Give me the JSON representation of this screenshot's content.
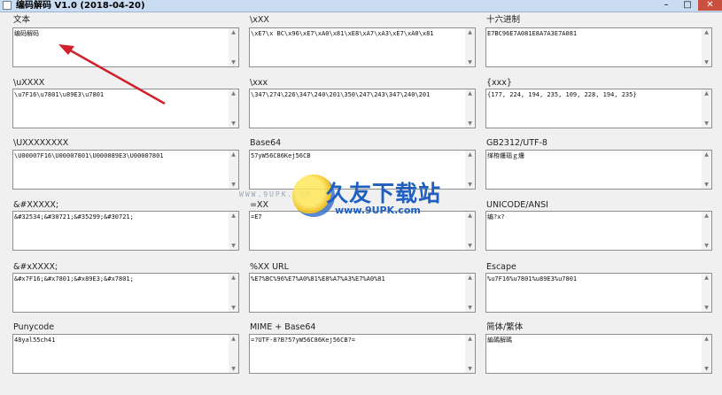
{
  "window": {
    "title": "编码解码 V1.0  (2018-04-20)",
    "controls": {
      "minimize": "–",
      "maximize": "□",
      "close": "✕"
    }
  },
  "fields": [
    {
      "label": "文本",
      "value": "编码解码"
    },
    {
      "label": "\\xXX",
      "value": "\\xE7\\x BC\\x96\\xE7\\xA0\\x81\\xE8\\xA7\\xA3\\xE7\\xA0\\x81"
    },
    {
      "label": "十六进制",
      "value": "E7BC96E7A081E8A7A3E7A081"
    },
    {
      "label": "\\uXXXX",
      "value": "\\u7F16\\u7801\\u89E3\\u7801"
    },
    {
      "label": "\\xxx",
      "value": "\\347\\274\\226\\347\\240\\201\\350\\247\\243\\347\\240\\201"
    },
    {
      "label": "{xxx}",
      "value": "{177, 224, 194, 235, 109, 228, 194, 235}"
    },
    {
      "label": "\\UXXXXXXXX",
      "value": "\\U00007F16\\U00007801\\U000089E3\\U00007801"
    },
    {
      "label": "Base64",
      "value": "57yW56C86Kej56CB"
    },
    {
      "label": "GB2312/UTF-8",
      "value": "缂栫爜瑙ｇ爜"
    },
    {
      "label": "&#XXXXX;",
      "value": "&#32534;&#30721;&#35299;&#30721;"
    },
    {
      "label": "=XX",
      "value": "=E7"
    },
    {
      "label": "UNICODE/ANSI",
      "value": "编?x?"
    },
    {
      "label": "&#xXXXX;",
      "value": "&#x7F16;&#x7801;&#x89E3;&#x7801;"
    },
    {
      "label": "%XX    URL",
      "value": "%E7%BC%96%E7%A0%81%E8%A7%A3%E7%A0%81"
    },
    {
      "label": "Escape",
      "value": "%u7F16%u7801%u89E3%u7801"
    },
    {
      "label": "Punycode",
      "value": "48yal55ch41"
    },
    {
      "label": "MIME + Base64",
      "value": "=?UTF-8?B?57yW56C86Kej56CB?="
    },
    {
      "label": "简体/繁体",
      "value": "編碼解碼"
    }
  ],
  "watermark": {
    "small": "WWW.9UPK.COM",
    "cn": "久友下载站",
    "url": "www.9UPK.com"
  },
  "colors": {
    "arrow": "#d0212a",
    "titlebar": "#c9dcf1",
    "close": "#c9503f"
  },
  "icons": {
    "scroll_up": "▲",
    "scroll_down": "▼"
  }
}
